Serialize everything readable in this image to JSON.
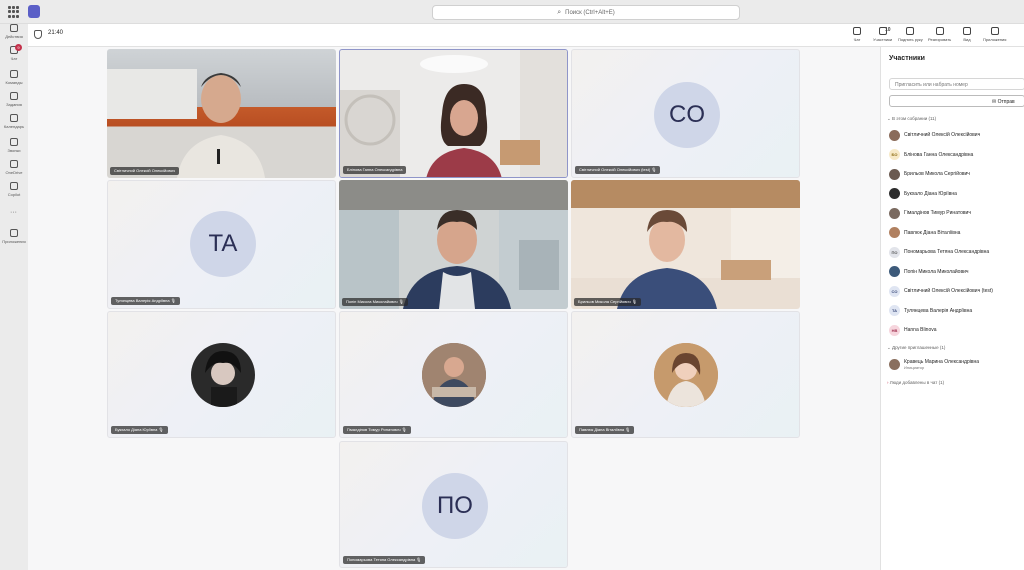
{
  "search": {
    "placeholder": "Поиск (Ctrl+Alt+E)"
  },
  "rail": [
    {
      "label": "Действия",
      "icon": "bell-icon"
    },
    {
      "label": "Чат",
      "icon": "chat-icon",
      "badge": "9"
    },
    {
      "label": "Команды",
      "icon": "teams-icon"
    },
    {
      "label": "Задания",
      "icon": "assignments-icon"
    },
    {
      "label": "Календарь",
      "icon": "calendar-icon"
    },
    {
      "label": "Звонки",
      "icon": "phone-icon"
    },
    {
      "label": "OneDrive",
      "icon": "cloud-icon"
    },
    {
      "label": "Copilot",
      "icon": "copilot-icon"
    },
    {
      "label": "...",
      "icon": "more-icon"
    },
    {
      "label": "Приложения",
      "icon": "apps-icon"
    }
  ],
  "meeting": {
    "timer": "21:40"
  },
  "toolbar": [
    {
      "label": "Чат",
      "icon": "chat-icon"
    },
    {
      "label": "Участники",
      "icon": "people-icon",
      "count": "10"
    },
    {
      "label": "Поднять руку",
      "icon": "hand-icon"
    },
    {
      "label": "Реагировать",
      "icon": "emoji-icon"
    },
    {
      "label": "Вид",
      "icon": "grid-icon"
    },
    {
      "label": "Приложения",
      "icon": "plus-icon"
    }
  ],
  "tiles": [
    {
      "name": "Світличний Олексій Олексійович",
      "type": "video"
    },
    {
      "name": "Блінова Ганна Олександрівна",
      "type": "video"
    },
    {
      "name": "Світличний Олексій Олексійович (test)",
      "type": "initials",
      "initials": "CO",
      "muted": true
    },
    {
      "name": "Тулянцева Валерія Андріївна",
      "type": "initials",
      "initials": "TA",
      "muted": true
    },
    {
      "name": "Попін Микола Миколайович",
      "type": "video",
      "muted": true
    },
    {
      "name": "Брильов Микола Сергійович",
      "type": "video",
      "muted": true
    },
    {
      "name": "Букхало Діана Юріївна",
      "type": "avatar",
      "muted": true
    },
    {
      "name": "Гімалдінов Тимур Ринатович",
      "type": "avatar",
      "muted": true
    },
    {
      "name": "Павлюк Діана Віталіївна",
      "type": "avatar",
      "muted": true
    },
    {
      "name": "Пономарьова Тетяна Олександрівна",
      "type": "initials",
      "initials": "ПО",
      "muted": true
    }
  ],
  "panel": {
    "title": "Участники",
    "invite_placeholder": "Пригласить или набрать номер",
    "send_label": "Отправ",
    "in_meeting_label": "В этом собрании (11)",
    "participants": [
      {
        "name": "Світличний Олексій Олексійович",
        "avatar": "photo",
        "color": "#8a6b5a"
      },
      {
        "name": "Блінова Ганна Олександрівна",
        "avatar": "initials",
        "initials": "БО",
        "color": "#f7e9c7",
        "text_color": "#8a6a10"
      },
      {
        "name": "Брильов Микола Сергійович",
        "avatar": "photo",
        "color": "#6b5a50"
      },
      {
        "name": "Букхало Діана Юріївна",
        "avatar": "photo",
        "color": "#2d2d2d"
      },
      {
        "name": "Гімалдінов Тимур Ринатович",
        "avatar": "photo",
        "color": "#7a6a60"
      },
      {
        "name": "Павлюк Діана Віталіївна",
        "avatar": "photo",
        "color": "#b08060"
      },
      {
        "name": "Пономарьова Тетяна Олександрівна",
        "avatar": "initials",
        "initials": "ПО",
        "color": "#e2e4ea",
        "text_color": "#555"
      },
      {
        "name": "Попін Микола Миколайович",
        "avatar": "photo",
        "color": "#3d5a7a"
      },
      {
        "name": "Світличний Олексій Олексійович (test)",
        "avatar": "initials",
        "initials": "CO",
        "color": "#dfe5f2",
        "text_color": "#3a4a7a"
      },
      {
        "name": "Тулянцева Валерія Андріївна",
        "avatar": "initials",
        "initials": "TA",
        "color": "#dfe5f2",
        "text_color": "#3a4a7a"
      },
      {
        "name": "Hanna Blinova",
        "avatar": "initials",
        "initials": "HB",
        "color": "#f6d5dd",
        "text_color": "#a03050"
      }
    ],
    "others_label": "Другие приглашенные (1)",
    "invited": [
      {
        "name": "Кравець Марина Олександрівна",
        "role": "Инициатор"
      }
    ],
    "chat_label": "Люди добавлены в чат (1)"
  }
}
